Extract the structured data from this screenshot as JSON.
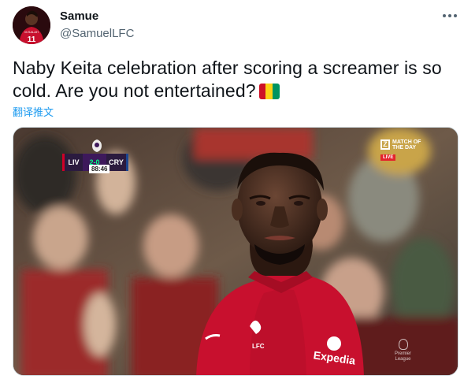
{
  "user": {
    "display_name": "Samue",
    "handle": "@SamuelLFC",
    "avatar_jersey_text": "M.SALAH",
    "avatar_jersey_number": "11"
  },
  "tweet": {
    "text": "Naby Keita celebration after scoring a screamer is so cold. Are you not entertained?",
    "emoji": "guinea-flag-emoji",
    "translate_label": "翻译推文"
  },
  "media": {
    "scorebug": {
      "home": "LIV",
      "score": "2-0",
      "away": "CRY",
      "clock": "88:46"
    },
    "broadcaster": {
      "logo_letter": "Z",
      "line1": "MATCH OF",
      "line2": "THE DAY",
      "live": "LIVE"
    },
    "watermark": {
      "line1": "Premier",
      "line2": "League"
    },
    "shirt_sponsor": "Expedia",
    "shirt_badge": "LFC"
  },
  "colors": {
    "text_primary": "#0f1419",
    "text_secondary": "#536471",
    "link": "#1d9bf0",
    "flag_red": "#ce1126",
    "flag_yellow": "#fcd116",
    "flag_green": "#009460",
    "shirt_red": "#c8102e"
  }
}
